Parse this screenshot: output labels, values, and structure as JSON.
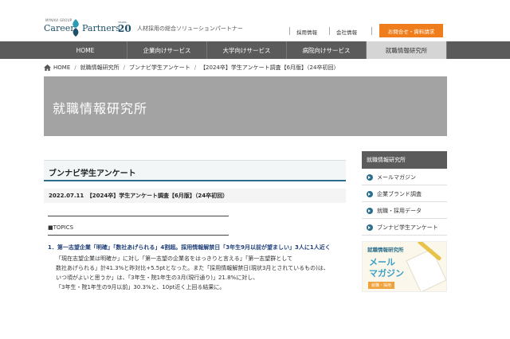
{
  "header": {
    "logo_small": "MYNAVI GROUP",
    "logo_career": "Career",
    "logo_partners": "Partners",
    "logo_badge_num": "20",
    "logo_badge_small": "YEARS",
    "tagline": "人材採用の総合ソリューションパートナー",
    "util_links": [
      "採用情報",
      "会社情報"
    ],
    "cta_label": "お問合せ・資料請求"
  },
  "nav": {
    "items": [
      "HOME",
      "企業向けサービス",
      "大学向けサービス",
      "病院向けサービス",
      "就職情報研究所"
    ],
    "active_index": 4
  },
  "breadcrumb": {
    "items": [
      "HOME",
      "就職情報研究所",
      "ブンナビ学生アンケート",
      "【2024卒】学生アンケート調査【6月版】（24卒初回）"
    ]
  },
  "hero": {
    "title": "就職情報研究所"
  },
  "main": {
    "section_title": "ブンナビ学生アンケート",
    "article_line": "2022.07.11　【2024卒】学生アンケート調査【6月版】（24卒初回）",
    "topics_label": "■TOPICS",
    "point1_title": "1．第一志望企業「明確」「数社あげられる」4割超。採用情報解禁日「3年生9月以前が望ましい」3人に1人近く",
    "body_lines": [
      "「現在志望企業は明確か」に対し「第一志望の企業名をはっきりと言える」「第一志望群として",
      "数社あげられる」計41.3%と昨対比+5.5ptとなった。また「採用情報解禁日(現状3月とされているもの)は、",
      "いつ頃がよいと思うか」は、「3年生・院1年生の3月(現行通り)」21.8%に対し、",
      "「3年生・院1年生の9月以前」30.3%と、10pt近く上回る結果に。"
    ]
  },
  "sidebar": {
    "heading": "就職情報研究所",
    "items": [
      "メールマガジン",
      "企業ブランド調査",
      "就職・採用データ",
      "ブンナビ学生アンケート"
    ],
    "banner": {
      "brand": "就職情報研究所",
      "title1": "メール",
      "title2": "マガジン",
      "pill": "就職・採用"
    }
  },
  "colors": {
    "accent_orange": "#ef7d1b",
    "nav_bg": "#5b5b5b",
    "hero_bg": "#a3a3a3",
    "brand_teal": "#2c6f8c"
  }
}
